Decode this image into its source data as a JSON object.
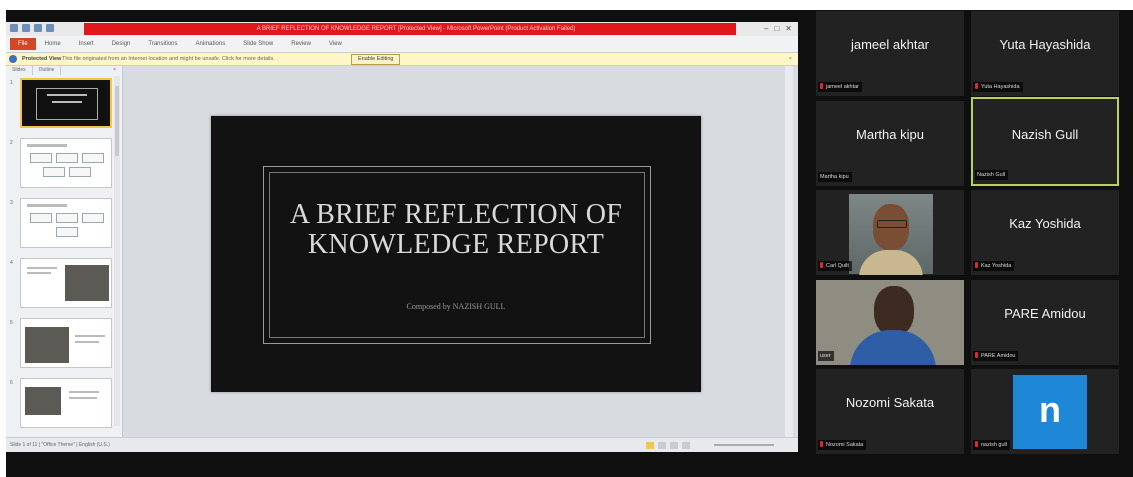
{
  "powerpoint": {
    "window_title": "A BRIEF REFLECTION OF KNOWLEDGE REPORT [Protected View] - Microsoft PowerPoint (Product Activation Failed)",
    "ribbon_tabs": [
      "File",
      "Home",
      "Insert",
      "Design",
      "Transitions",
      "Animations",
      "Slide Show",
      "Review",
      "View"
    ],
    "protected_view": {
      "label": "Protected View",
      "message": "This file originated from an Internet location and might be unsafe. Click for more details.",
      "button": "Enable Editing"
    },
    "pane_tabs": [
      "Slides",
      "Outline"
    ],
    "slide_numbers": [
      "1",
      "2",
      "3",
      "4",
      "5",
      "6"
    ],
    "slide": {
      "title": "A BRIEF REFLECTION OF KNOWLEDGE REPORT",
      "subtitle": "Composed by NAZISH GULL"
    },
    "status_text": "Slide 1 of 11  |  \"Office Theme\"  |  English (U.S.)"
  },
  "participants": [
    {
      "display": "jameel akhtar",
      "label": "jameel akhtar",
      "muted": true,
      "video": false,
      "active": false
    },
    {
      "display": "Yuta Hayashida",
      "label": "Yuta Hayashida",
      "muted": true,
      "video": false,
      "active": false
    },
    {
      "display": "Martha kipu",
      "label": "Martha kipu",
      "muted": false,
      "video": false,
      "active": false
    },
    {
      "display": "Nazish Gull",
      "label": "Nazish Gull",
      "muted": false,
      "video": false,
      "active": true
    },
    {
      "display": "",
      "label": "Carl Quilt",
      "muted": true,
      "video": true,
      "active": false
    },
    {
      "display": "Kaz Yoshida",
      "label": "Kaz Yoshida",
      "muted": true,
      "video": false,
      "active": false
    },
    {
      "display": "",
      "label": "user",
      "muted": false,
      "video": true,
      "active": false
    },
    {
      "display": "PARE Amidou",
      "label": "PARE Amidou",
      "muted": true,
      "video": false,
      "active": false
    },
    {
      "display": "Nozomi Sakata",
      "label": "Nozomi Sakata",
      "muted": true,
      "video": false,
      "active": false
    },
    {
      "display": "n",
      "label": "nazish gull",
      "muted": true,
      "video": false,
      "active": false
    }
  ],
  "colors": {
    "title_bar_red": "#e0171b",
    "protected_bar": "#fff6c8",
    "active_speaker_border": "#b9d35a",
    "avatar_blue": "#1e88d6",
    "mic_muted": "#e02828"
  }
}
